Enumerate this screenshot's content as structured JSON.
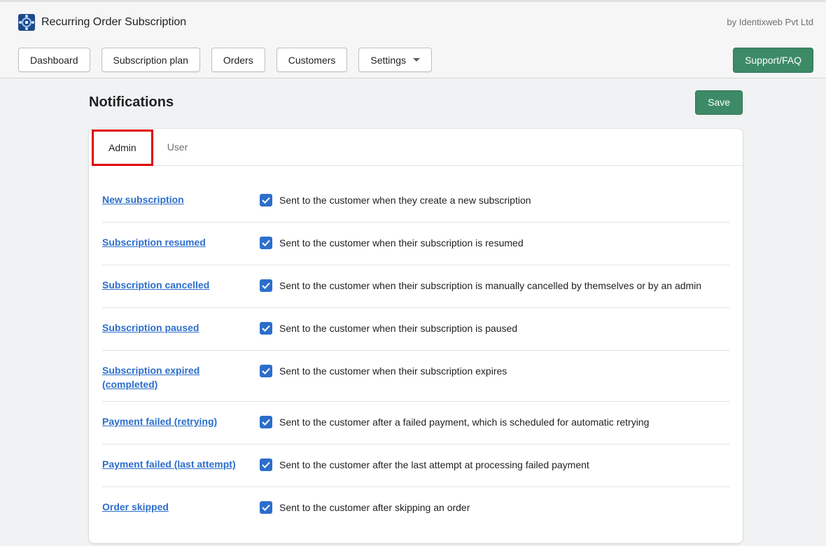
{
  "app": {
    "title": "Recurring Order Subscription",
    "vendor": "by Identixweb Pvt Ltd"
  },
  "nav": {
    "items": [
      "Dashboard",
      "Subscription plan",
      "Orders",
      "Customers",
      "Settings"
    ],
    "support_label": "Support/FAQ"
  },
  "page": {
    "title": "Notifications",
    "save_label": "Save"
  },
  "tabs": [
    {
      "label": "Admin",
      "active": true
    },
    {
      "label": "User",
      "active": false
    }
  ],
  "notifications": [
    {
      "name": "New subscription",
      "checked": true,
      "description": "Sent to the customer when they create a new subscription"
    },
    {
      "name": "Subscription resumed",
      "checked": true,
      "description": "Sent to the customer when their subscription is resumed"
    },
    {
      "name": "Subscription cancelled",
      "checked": true,
      "description": "Sent to the customer when their subscription is manually cancelled by themselves or by an admin"
    },
    {
      "name": "Subscription paused",
      "checked": true,
      "description": "Sent to the customer when their subscription is paused"
    },
    {
      "name": "Subscription expired (completed)",
      "checked": true,
      "description": "Sent to the customer when their subscription expires"
    },
    {
      "name": "Payment failed (retrying)",
      "checked": true,
      "description": "Sent to the customer after a failed payment, which is scheduled for automatic retrying"
    },
    {
      "name": "Payment failed (last attempt)",
      "checked": true,
      "description": "Sent to the customer after the last attempt at processing failed payment"
    },
    {
      "name": "Order skipped",
      "checked": true,
      "description": "Sent to the customer after skipping an order"
    }
  ],
  "colors": {
    "primary_green": "#3d8a67",
    "link_blue": "#2c6ecb",
    "highlight_red": "#e00000"
  }
}
